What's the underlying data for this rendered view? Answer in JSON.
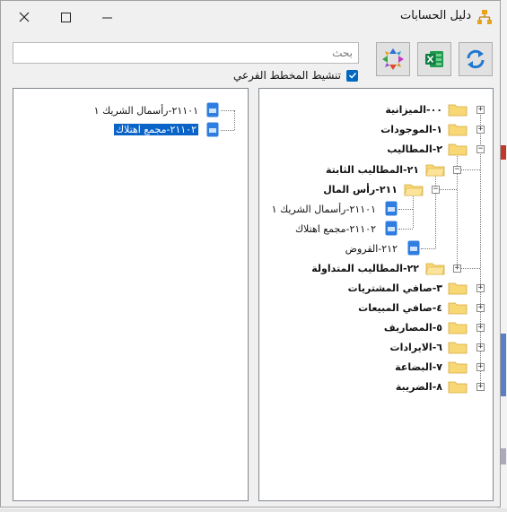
{
  "window": {
    "title": "دليل الحسابات"
  },
  "search": {
    "placeholder": "بحث",
    "value": ""
  },
  "checkbox": {
    "label": "تنشيط المخطط الفرعي",
    "checked": true
  },
  "toolbar": {
    "refresh_icon": "refresh-icon",
    "excel_icon": "excel-icon",
    "expand_icon": "expand-arrows-icon"
  },
  "tree": {
    "n00": "٠٠-الميزانية",
    "n1": "١-الموجودات",
    "n2": "٢-المطاليب",
    "n21": "٢١-المطاليب الثابتة",
    "n211": "٢١١-رأس المال",
    "n21101": "٢١١٠١-رأسمال الشريك ١",
    "n21102": "٢١١٠٢-مجمع اهتلاك",
    "n212": "٢١٢-القروض",
    "n22": "٢٢-المطاليب المتداولة",
    "n3": "٣-صافي المشتريات",
    "n4": "٤-صافي المبيعات",
    "n5": "٥-المصاريف",
    "n6": "٦-الايرادات",
    "n7": "٧-البضاعة",
    "n8": "٨-الضريبة"
  },
  "subtree": {
    "item1": "٢١١٠١-رأسمال الشريك ١",
    "item2": "٢١١٠٢-مجمع اهتلاك"
  },
  "colors": {
    "accent": "#0067c0",
    "selection": "#0a64c8",
    "folder": "#f8d775"
  }
}
